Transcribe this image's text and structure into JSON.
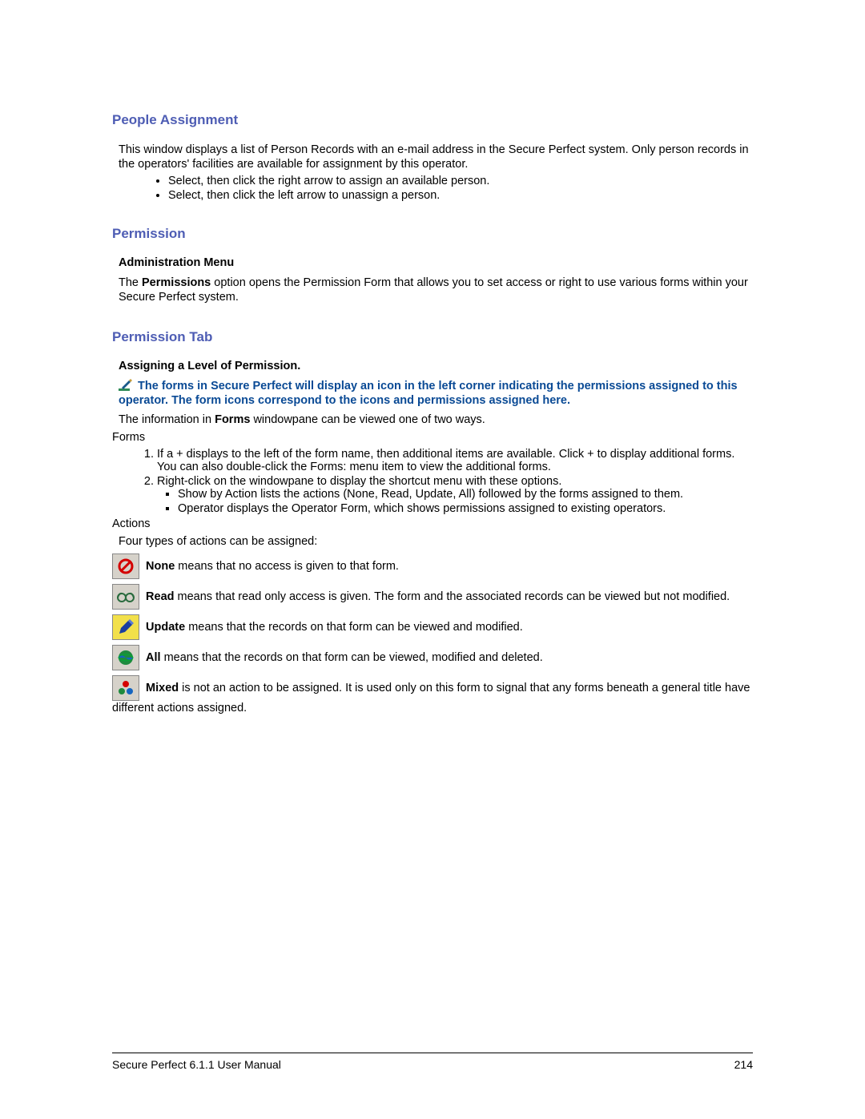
{
  "sections": {
    "people_assignment": {
      "title": "People Assignment",
      "intro": "This window displays a list of Person Records with an e-mail address in the Secure Perfect system. Only person records in the operators' facilities are available for assignment by this operator.",
      "bullets": [
        "Select, then click the right arrow to assign an available person.",
        "Select, then click the left arrow to unassign a person."
      ]
    },
    "permission": {
      "title": "Permission",
      "subheading": "Administration Menu",
      "para_pre": "The ",
      "para_bold": "Permissions",
      "para_post": " option opens the Permission Form that allows you to set access or right to use various forms within your Secure Perfect system."
    },
    "permission_tab": {
      "title": "Permission Tab",
      "subheading": "Assigning a Level of Permission.",
      "tip": "The forms in Secure Perfect will display an icon in the left corner indicating the permissions assigned to this operator. The form icons correspond to the icons and permissions assigned here.",
      "info_pre": "The information in ",
      "info_bold": "Forms",
      "info_post": " windowpane can be viewed one of two ways.",
      "forms_label": "Forms",
      "ol": [
        "If a + displays to the left of the form name, then additional items are available. Click + to display additional forms. You can also double-click the Forms: menu item to view the additional forms.",
        "Right-click on the windowpane to display the shortcut menu with these options."
      ],
      "ol2_sub": [
        "Show by Action lists the actions (None, Read, Update, All) followed by the forms assigned to them.",
        "Operator displays the Operator Form, which shows permissions assigned to existing operators."
      ],
      "actions_label": "Actions",
      "actions_intro": "Four types of actions can be assigned:",
      "actions": {
        "none": {
          "label": "None",
          "text": " means that no access is given to that form."
        },
        "read": {
          "label": "Read",
          "text": " means that read only access is given. The form and the associated records can be viewed but not modified."
        },
        "update": {
          "label": "Update",
          "text": " means that the records on that form can be viewed and modified."
        },
        "all": {
          "label": "All",
          "text": " means that the records on that form can be viewed, modified and deleted."
        },
        "mixed": {
          "label": "Mixed",
          "text": " is not an action to be assigned. It is used only on this form to signal that any forms beneath a general title have different actions assigned."
        }
      }
    }
  },
  "footer": {
    "left": "Secure Perfect 6.1.1 User Manual",
    "right": "214"
  }
}
